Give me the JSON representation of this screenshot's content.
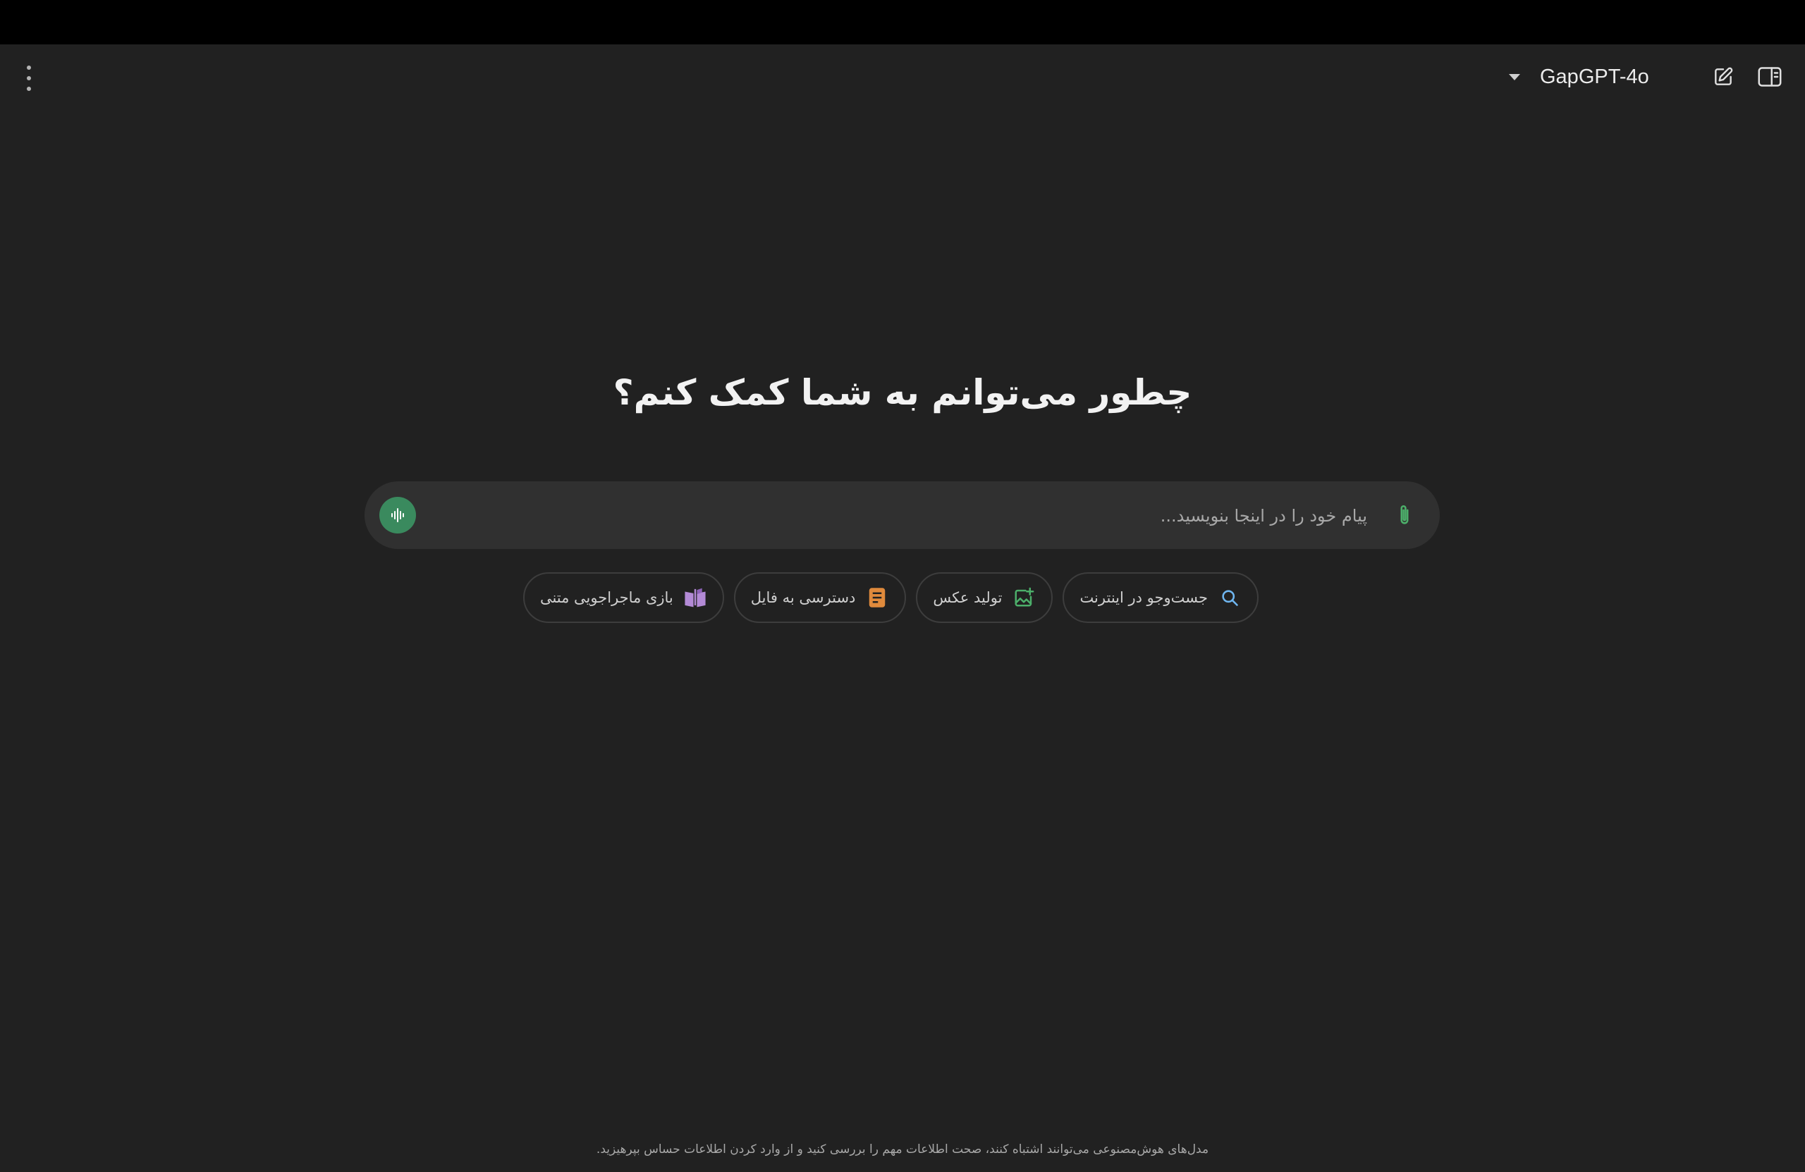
{
  "header": {
    "model_name": "GapGPT-4o"
  },
  "main": {
    "heading": "چطور می‌توانم به شما کمک کنم؟",
    "composer": {
      "placeholder": "پیام خود را در اینجا بنویسید..."
    },
    "chips": [
      {
        "label": "جست‌وجو در اینترنت",
        "icon": "search-icon",
        "color": "#6fb6f0"
      },
      {
        "label": "تولید عکس",
        "icon": "image-plus-icon",
        "color": "#4caf6a"
      },
      {
        "label": "دسترسی به فایل",
        "icon": "document-icon",
        "color": "#e08a3c"
      },
      {
        "label": "بازی ماجراجویی متنی",
        "icon": "book-icon",
        "color": "#b38ad6"
      }
    ]
  },
  "footer": {
    "disclaimer": "مدل‌های هوش‌مصنوعی می‌توانند اشتباه کنند، صحت اطلاعات مهم را بررسی کنید و از وارد کردن اطلاعات حساس بپرهیزید."
  },
  "colors": {
    "background": "#212121",
    "composer": "#303030",
    "voice_button": "#3a8a5e",
    "accent_green": "#4caf6a"
  }
}
